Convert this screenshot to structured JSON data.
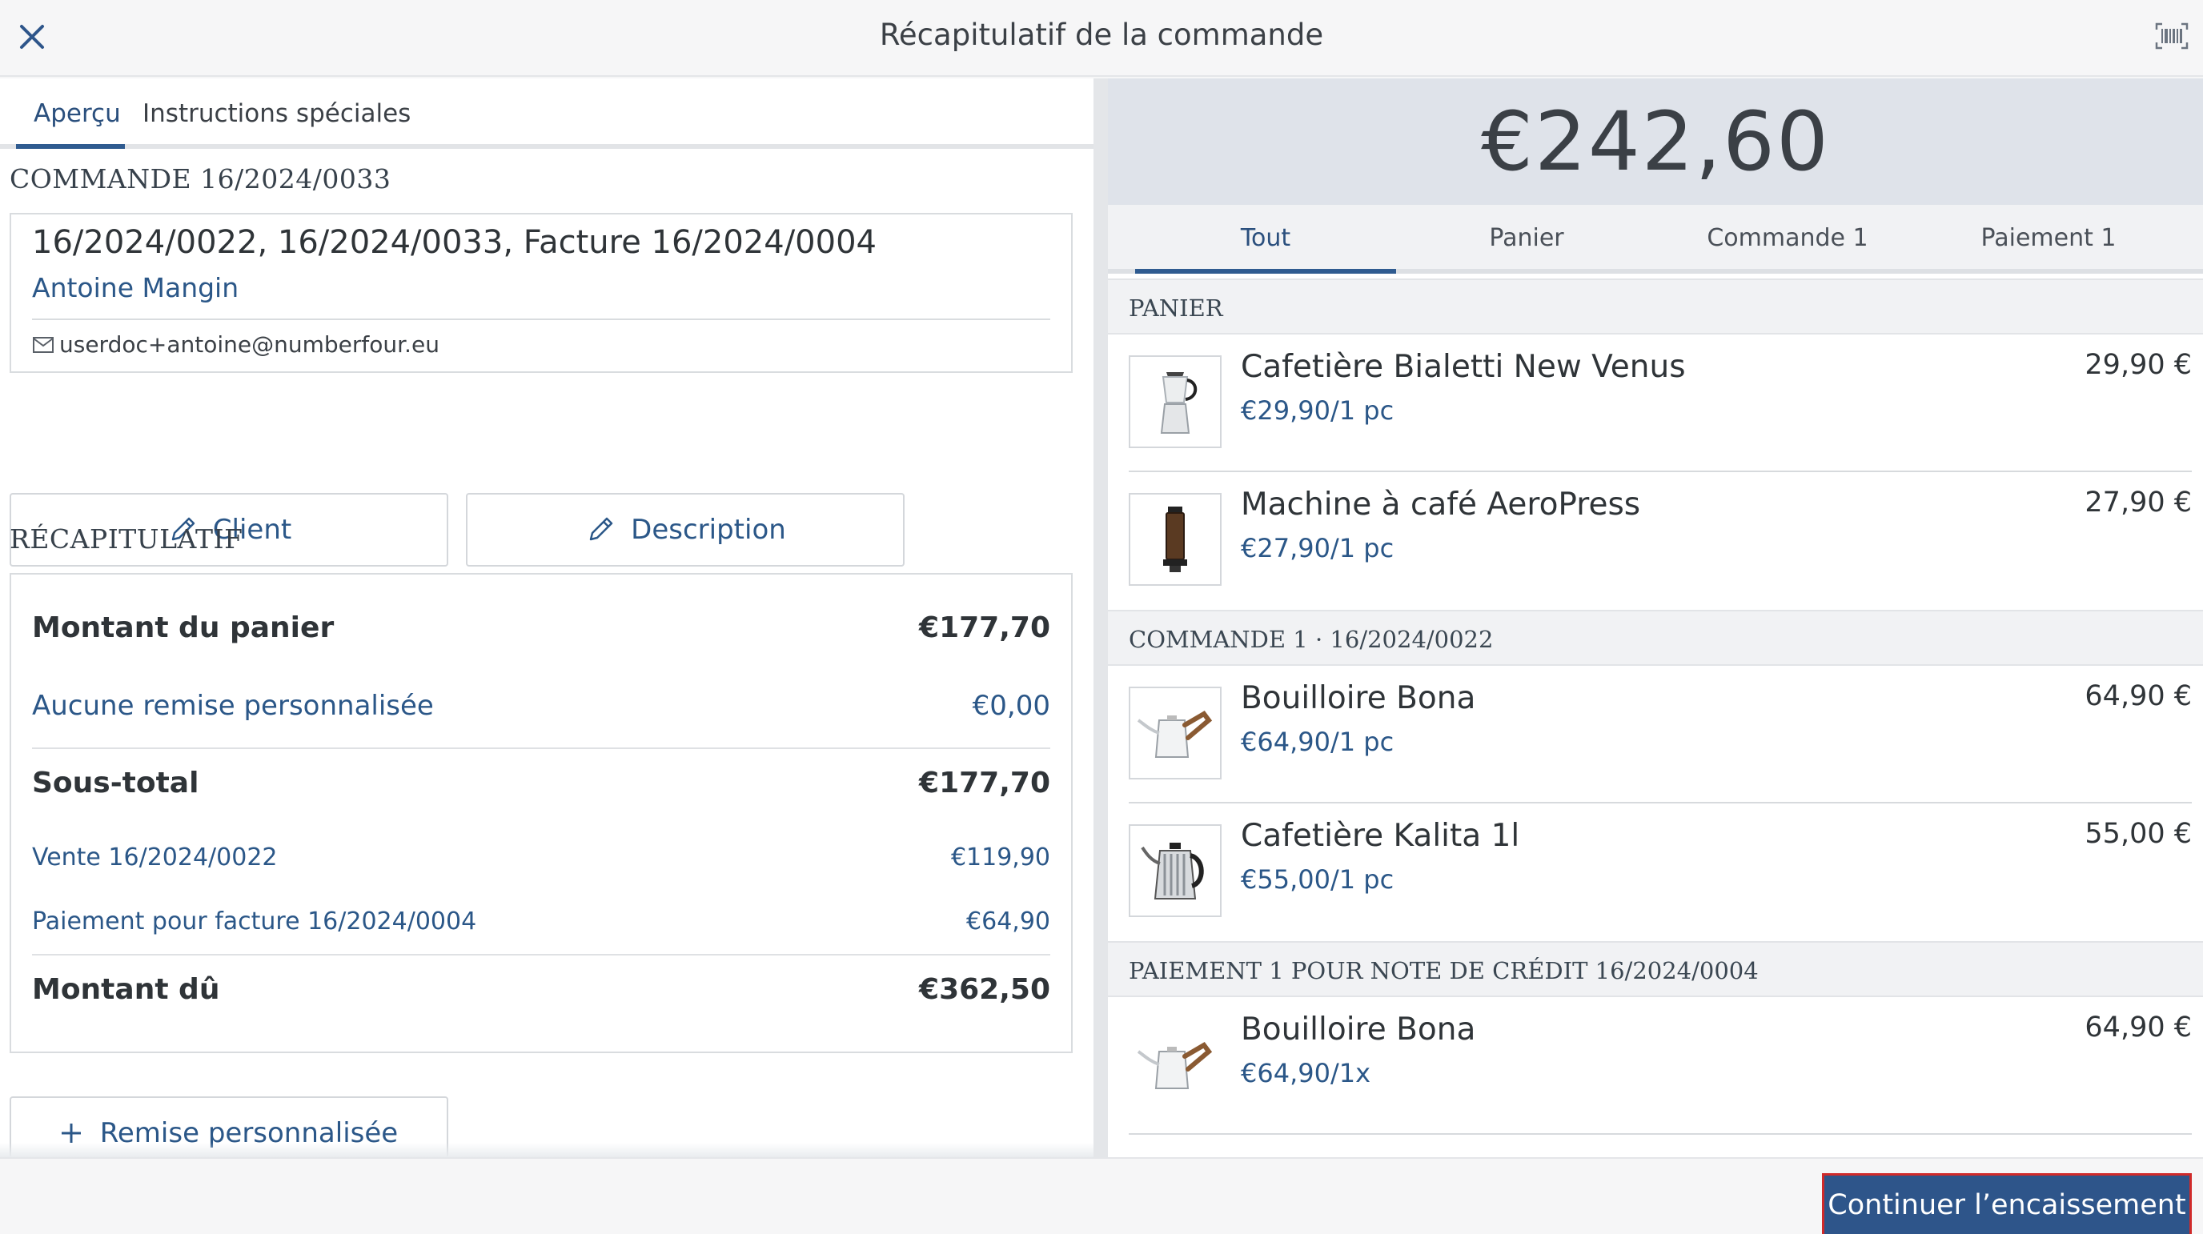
{
  "header": {
    "title": "Récapitulatif de la commande",
    "close_icon": "close-icon",
    "barcode_icon": "barcode-scan-icon"
  },
  "left": {
    "tabs": [
      {
        "label": "Aperçu",
        "active": true
      },
      {
        "label": "Instructions spéciales",
        "active": false
      }
    ],
    "order_label": "COMMANDE 16/2024/0033",
    "order_box": {
      "refs": "16/2024/0022, 16/2024/0033, Facture 16/2024/0004",
      "customer": "Antoine Mangin",
      "email": "userdoc+antoine@numberfour.eu"
    },
    "buttons": {
      "client": "Client",
      "description": "Description"
    },
    "summary_label": "RÉCAPITULATIF",
    "summary": {
      "cart_amount_label": "Montant du panier",
      "cart_amount_value": "€177,70",
      "discount_label": "Aucune remise personnalisée",
      "discount_value": "€0,00",
      "subtotal_label": "Sous-total",
      "subtotal_value": "€177,70",
      "sale_label": "Vente 16/2024/0022",
      "sale_value": "€119,90",
      "payment_label": "Paiement pour facture 16/2024/0004",
      "payment_value": "€64,90",
      "due_label": "Montant dû",
      "due_value": "€362,50"
    },
    "remise_button": "Remise personnalisée"
  },
  "right": {
    "total": "€242,60",
    "tabs": [
      {
        "label": "Tout",
        "active": true
      },
      {
        "label": "Panier",
        "active": false
      },
      {
        "label": "Commande 1",
        "active": false
      },
      {
        "label": "Paiement 1",
        "active": false
      }
    ],
    "sections": [
      {
        "title": "PANIER",
        "items": [
          {
            "name": "Cafetière Bialetti New Venus",
            "unit": "€29,90/1 pc",
            "price": "29,90 €",
            "icon": "moka-pot-icon"
          },
          {
            "name": "Machine à café AeroPress",
            "unit": "€27,90/1 pc",
            "price": "27,90 €",
            "icon": "aeropress-icon"
          }
        ]
      },
      {
        "title": "COMMANDE 1 · 16/2024/0022",
        "items": [
          {
            "name": "Bouilloire Bona",
            "unit": "€64,90/1 pc",
            "price": "64,90 €",
            "icon": "kettle-icon"
          },
          {
            "name": "Cafetière Kalita 1l",
            "unit": "€55,00/1 pc",
            "price": "55,00 €",
            "icon": "kettle-steel-icon"
          }
        ]
      },
      {
        "title": "PAIEMENT 1 POUR NOTE DE CRÉDIT 16/2024/0004",
        "items": [
          {
            "name": "Bouilloire Bona",
            "unit": "€64,90/1x",
            "price": "64,90 €",
            "icon": "kettle-icon"
          }
        ]
      }
    ]
  },
  "footer": {
    "continue": "Continuer l’encaissement"
  },
  "colors": {
    "accent": "#2e558a",
    "link": "#2b5788",
    "highlight_border": "#d02a2a"
  }
}
